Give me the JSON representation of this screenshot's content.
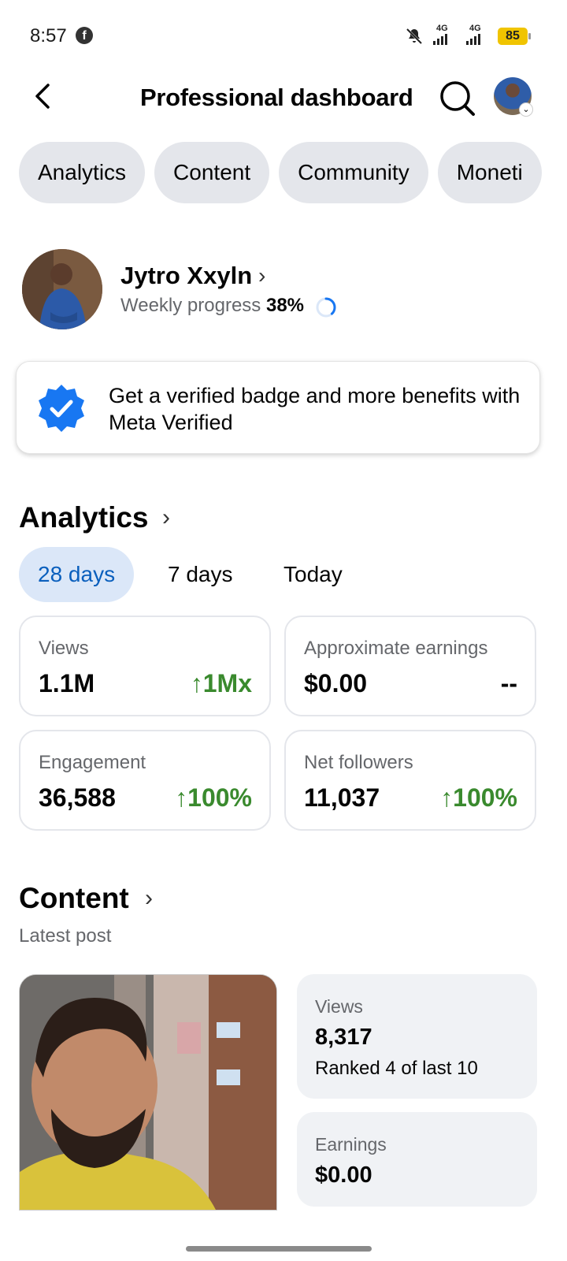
{
  "status_bar": {
    "time": "8:57",
    "signal_1_label": "4G",
    "signal_2_label": "4G",
    "battery": "85"
  },
  "header": {
    "title": "Professional dashboard"
  },
  "chips": [
    "Analytics",
    "Content",
    "Community",
    "Moneti"
  ],
  "profile": {
    "name": "Jytro Xxyln",
    "progress_label": "Weekly progress",
    "progress_value": "38%",
    "progress_fraction": 0.38
  },
  "verified_card": {
    "text": "Get a verified badge and more benefits with Meta Verified"
  },
  "analytics": {
    "title": "Analytics",
    "tabs": [
      "28 days",
      "7 days",
      "Today"
    ],
    "cards": [
      {
        "label": "Views",
        "value": "1.1M",
        "change": "↑1Mx"
      },
      {
        "label": "Approximate earnings",
        "value": "$0.00",
        "change": "--"
      },
      {
        "label": "Engagement",
        "value": "36,588",
        "change": "↑100%"
      },
      {
        "label": "Net followers",
        "value": "11,037",
        "change": "↑100%"
      }
    ]
  },
  "content": {
    "title": "Content",
    "subtitle": "Latest post",
    "views_label": "Views",
    "views_value": "8,317",
    "views_rank": "Ranked 4 of last 10",
    "earnings_label": "Earnings",
    "earnings_value": "$0.00"
  },
  "colors": {
    "accent_blue": "#0a5fbd",
    "positive_green": "#3a8a2e",
    "chip_bg": "#e4e6eb",
    "tab_active_bg": "#dbe7f8"
  }
}
